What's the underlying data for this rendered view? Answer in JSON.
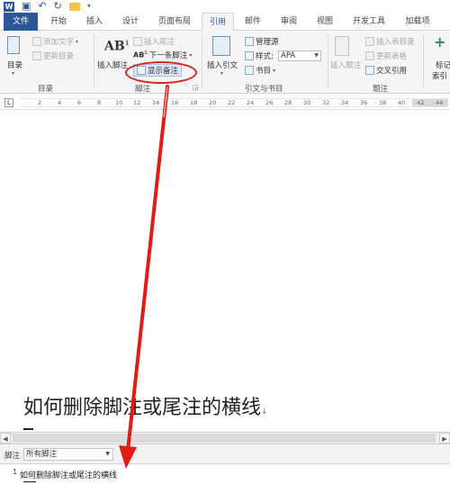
{
  "window": {
    "app_icon": "word-icon",
    "app_icon_label": "W"
  },
  "tabs": [
    {
      "label": "文件"
    },
    {
      "label": "开始"
    },
    {
      "label": "插入"
    },
    {
      "label": "设计"
    },
    {
      "label": "页面布局"
    },
    {
      "label": "引用"
    },
    {
      "label": "邮件"
    },
    {
      "label": "审阅"
    },
    {
      "label": "视图"
    },
    {
      "label": "开发工具"
    },
    {
      "label": "加载项"
    }
  ],
  "ribbon": {
    "toc": {
      "toc_label": "目录",
      "add_text": "添加文字",
      "update_toc": "更新目录",
      "group_label": "目录"
    },
    "footnotes": {
      "insert_footnote": "插入脚注",
      "insert_endnote": "插入尾注",
      "next_footnote": "下一条脚注",
      "show_notes": "显示备注",
      "group_label": "脚注",
      "ab_glyph": "AB",
      "ab_sup": "1",
      "next_glyph": "AB",
      "next_sup": "1"
    },
    "citations": {
      "insert_citation": "插入引文",
      "manage_sources": "管理源",
      "style_label": "样式:",
      "style_value": "APA",
      "bibliography": "书目",
      "group_label": "引文与书目"
    },
    "captions": {
      "insert_caption": "插入题注",
      "insert_table_of_figures": "插入表目录",
      "update_table": "更新表格",
      "cross_reference": "交叉引用",
      "group_label": "题注"
    },
    "index": {
      "mark_entry": "标记",
      "index_label": "索引"
    },
    "accent_color": "#2b579a",
    "highlight_color": "#d9231d"
  },
  "ruler": {
    "ticks": [
      "2",
      "4",
      "6",
      "8",
      "10",
      "12",
      "14",
      "16",
      "18",
      "20",
      "22",
      "24",
      "26",
      "28",
      "30",
      "32",
      "34",
      "36",
      "38",
      "40",
      "42",
      "44"
    ],
    "tab_selector": "L"
  },
  "document": {
    "heading": "如何删除脚注或尾注的横线",
    "paragraph_mark": "↓"
  },
  "footnote_pane": {
    "label": "脚注",
    "filter_value": "所有脚注",
    "note_ref": "1",
    "note_text": "如何删除脚注或尾注的横线"
  }
}
